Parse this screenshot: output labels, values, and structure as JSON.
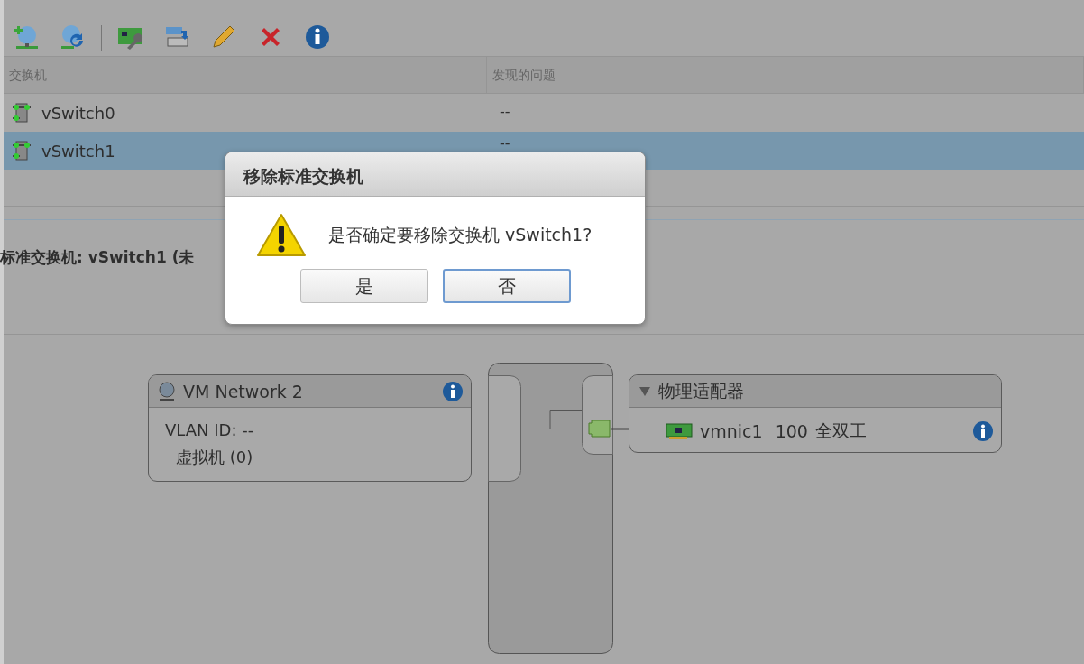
{
  "table": {
    "columns": [
      "交换机",
      "发现的问题"
    ],
    "rows": [
      {
        "switch": "vSwitch0",
        "issues": "--",
        "selected": false
      },
      {
        "switch": "vSwitch1",
        "issues": "--",
        "selected": true
      }
    ]
  },
  "details": {
    "heading": "标准交换机: vSwitch1 (未"
  },
  "diagram": {
    "port_group": {
      "name": "VM Network 2",
      "vlan": "VLAN ID: --",
      "vms": "虚拟机 (0)"
    },
    "adapters": {
      "title": "物理适配器",
      "expanded": true,
      "nics": [
        {
          "name": "vmnic1",
          "speed": "100",
          "duplex": "全双工"
        }
      ]
    }
  },
  "dialog": {
    "title": "移除标准交换机",
    "message": "是否确定要移除交换机 vSwitch1?",
    "buttons": [
      {
        "label": "是",
        "focused": false
      },
      {
        "label": "否",
        "focused": true
      }
    ]
  }
}
